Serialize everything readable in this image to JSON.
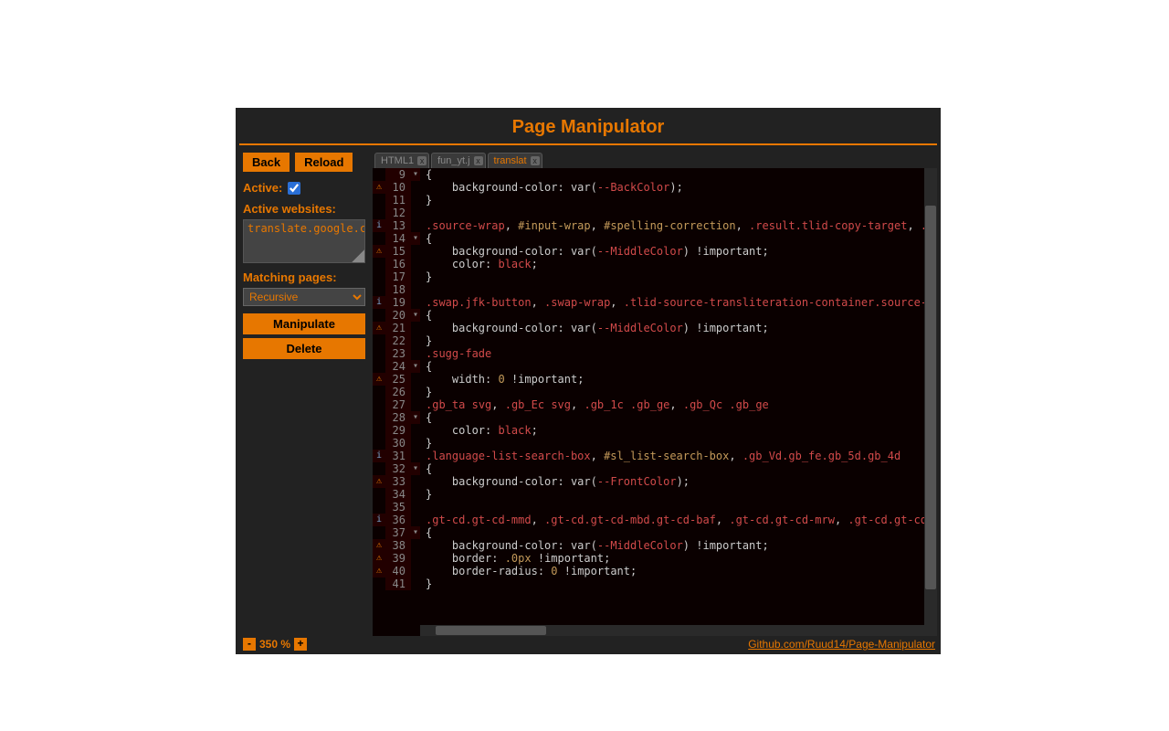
{
  "title": "Page Manipulator",
  "sidebar": {
    "back_label": "Back",
    "reload_label": "Reload",
    "active_label": "Active:",
    "active_checked": true,
    "active_websites_label": "Active websites:",
    "active_websites_value": "translate.google.c",
    "matching_pages_label": "Matching pages:",
    "matching_select_value": "Recursive",
    "manipulate_label": "Manipulate",
    "delete_label": "Delete"
  },
  "tabs": [
    {
      "label": "HTML1",
      "active": false
    },
    {
      "label": "fun_yt.j",
      "active": false
    },
    {
      "label": "translat",
      "active": true
    }
  ],
  "zoom": {
    "minus": "-",
    "plus": "+",
    "value": "350 %"
  },
  "github_link": "Github.com/Ruud14/Page-Manipulator",
  "code_lines": [
    {
      "n": 9,
      "icon": "",
      "fold": "▾",
      "tokens": [
        [
          "punc",
          "{"
        ]
      ]
    },
    {
      "n": 10,
      "icon": "⚠",
      "fold": "",
      "tokens": [
        [
          "prop",
          "    background-color"
        ],
        [
          "punc",
          ": "
        ],
        [
          "var",
          "var"
        ],
        [
          "punc",
          "("
        ],
        [
          "val",
          "--BackColor"
        ],
        [
          "punc",
          ");"
        ]
      ]
    },
    {
      "n": 11,
      "icon": "",
      "fold": "",
      "tokens": [
        [
          "punc",
          "}"
        ]
      ]
    },
    {
      "n": 12,
      "icon": "",
      "fold": "",
      "tokens": []
    },
    {
      "n": 13,
      "icon": "i",
      "fold": "",
      "tokens": [
        [
          "sel",
          ".source-wrap"
        ],
        [
          "punc",
          ", "
        ],
        [
          "id",
          "#input-wrap"
        ],
        [
          "punc",
          ", "
        ],
        [
          "id",
          "#spelling-correction"
        ],
        [
          "punc",
          ", "
        ],
        [
          "sel",
          ".result.tlid-copy-target"
        ],
        [
          "punc",
          ", "
        ],
        [
          "sel",
          ".tli"
        ]
      ]
    },
    {
      "n": 14,
      "icon": "",
      "fold": "▾",
      "tokens": [
        [
          "punc",
          "{"
        ]
      ]
    },
    {
      "n": 15,
      "icon": "⚠",
      "fold": "",
      "tokens": [
        [
          "prop",
          "    background-color"
        ],
        [
          "punc",
          ": "
        ],
        [
          "var",
          "var"
        ],
        [
          "punc",
          "("
        ],
        [
          "val",
          "--MiddleColor"
        ],
        [
          "punc",
          ") "
        ],
        [
          "imp",
          "!important"
        ],
        [
          "punc",
          ";"
        ]
      ]
    },
    {
      "n": 16,
      "icon": "",
      "fold": "",
      "tokens": [
        [
          "prop",
          "    color"
        ],
        [
          "punc",
          ": "
        ],
        [
          "val",
          "black"
        ],
        [
          "punc",
          ";"
        ]
      ]
    },
    {
      "n": 17,
      "icon": "",
      "fold": "",
      "tokens": [
        [
          "punc",
          "}"
        ]
      ]
    },
    {
      "n": 18,
      "icon": "",
      "fold": "",
      "tokens": []
    },
    {
      "n": 19,
      "icon": "i",
      "fold": "",
      "tokens": [
        [
          "sel",
          ".swap.jfk-button"
        ],
        [
          "punc",
          ", "
        ],
        [
          "sel",
          ".swap-wrap"
        ],
        [
          "punc",
          ", "
        ],
        [
          "sel",
          ".tlid-source-transliteration-container.source-tra"
        ]
      ]
    },
    {
      "n": 20,
      "icon": "",
      "fold": "▾",
      "tokens": [
        [
          "punc",
          "{"
        ]
      ]
    },
    {
      "n": 21,
      "icon": "⚠",
      "fold": "",
      "tokens": [
        [
          "prop",
          "    background-color"
        ],
        [
          "punc",
          ": "
        ],
        [
          "var",
          "var"
        ],
        [
          "punc",
          "("
        ],
        [
          "val",
          "--MiddleColor"
        ],
        [
          "punc",
          ") "
        ],
        [
          "imp",
          "!important"
        ],
        [
          "punc",
          ";"
        ]
      ]
    },
    {
      "n": 22,
      "icon": "",
      "fold": "",
      "tokens": [
        [
          "punc",
          "}"
        ]
      ]
    },
    {
      "n": 23,
      "icon": "",
      "fold": "",
      "tokens": [
        [
          "sel",
          ".sugg-fade"
        ]
      ]
    },
    {
      "n": 24,
      "icon": "",
      "fold": "▾",
      "tokens": [
        [
          "punc",
          "{"
        ]
      ]
    },
    {
      "n": 25,
      "icon": "⚠",
      "fold": "",
      "tokens": [
        [
          "prop",
          "    width"
        ],
        [
          "punc",
          ": "
        ],
        [
          "num",
          "0"
        ],
        [
          "punc",
          " "
        ],
        [
          "imp",
          "!important"
        ],
        [
          "punc",
          ";"
        ]
      ]
    },
    {
      "n": 26,
      "icon": "",
      "fold": "",
      "tokens": [
        [
          "punc",
          "}"
        ]
      ]
    },
    {
      "n": 27,
      "icon": "",
      "fold": "",
      "tokens": [
        [
          "sel",
          ".gb_ta"
        ],
        [
          "punc",
          " "
        ],
        [
          "val",
          "svg"
        ],
        [
          "punc",
          ", "
        ],
        [
          "sel",
          ".gb_Ec"
        ],
        [
          "punc",
          " "
        ],
        [
          "val",
          "svg"
        ],
        [
          "punc",
          ", "
        ],
        [
          "sel",
          ".gb_1c .gb_ge"
        ],
        [
          "punc",
          ", "
        ],
        [
          "sel",
          ".gb_Qc .gb_ge"
        ]
      ]
    },
    {
      "n": 28,
      "icon": "",
      "fold": "▾",
      "tokens": [
        [
          "punc",
          "{"
        ]
      ]
    },
    {
      "n": 29,
      "icon": "",
      "fold": "",
      "tokens": [
        [
          "prop",
          "    color"
        ],
        [
          "punc",
          ": "
        ],
        [
          "val",
          "black"
        ],
        [
          "punc",
          ";"
        ]
      ]
    },
    {
      "n": 30,
      "icon": "",
      "fold": "",
      "tokens": [
        [
          "punc",
          "}"
        ]
      ]
    },
    {
      "n": 31,
      "icon": "i",
      "fold": "",
      "tokens": [
        [
          "sel",
          ".language-list-search-box"
        ],
        [
          "punc",
          ", "
        ],
        [
          "id",
          "#sl_list-search-box"
        ],
        [
          "punc",
          ", "
        ],
        [
          "sel",
          ".gb_Vd.gb_fe.gb_5d.gb_4d"
        ]
      ]
    },
    {
      "n": 32,
      "icon": "",
      "fold": "▾",
      "tokens": [
        [
          "punc",
          "{"
        ]
      ]
    },
    {
      "n": 33,
      "icon": "⚠",
      "fold": "",
      "tokens": [
        [
          "prop",
          "    background-color"
        ],
        [
          "punc",
          ": "
        ],
        [
          "var",
          "var"
        ],
        [
          "punc",
          "("
        ],
        [
          "val",
          "--FrontColor"
        ],
        [
          "punc",
          ");"
        ]
      ]
    },
    {
      "n": 34,
      "icon": "",
      "fold": "",
      "tokens": [
        [
          "punc",
          "}"
        ]
      ]
    },
    {
      "n": 35,
      "icon": "",
      "fold": "",
      "tokens": []
    },
    {
      "n": 36,
      "icon": "i",
      "fold": "",
      "tokens": [
        [
          "sel",
          ".gt-cd.gt-cd-mmd"
        ],
        [
          "punc",
          ", "
        ],
        [
          "sel",
          ".gt-cd.gt-cd-mbd.gt-cd-baf"
        ],
        [
          "punc",
          ", "
        ],
        [
          "sel",
          ".gt-cd.gt-cd-mrw"
        ],
        [
          "punc",
          ", "
        ],
        [
          "sel",
          ".gt-cd.gt-cd-ms"
        ]
      ]
    },
    {
      "n": 37,
      "icon": "",
      "fold": "▾",
      "tokens": [
        [
          "punc",
          "{"
        ]
      ]
    },
    {
      "n": 38,
      "icon": "⚠",
      "fold": "",
      "tokens": [
        [
          "prop",
          "    background-color"
        ],
        [
          "punc",
          ": "
        ],
        [
          "var",
          "var"
        ],
        [
          "punc",
          "("
        ],
        [
          "val",
          "--MiddleColor"
        ],
        [
          "punc",
          ") "
        ],
        [
          "imp",
          "!important"
        ],
        [
          "punc",
          ";"
        ]
      ]
    },
    {
      "n": 39,
      "icon": "⚠",
      "fold": "",
      "tokens": [
        [
          "prop",
          "    border"
        ],
        [
          "punc",
          ": "
        ],
        [
          "num",
          ".0px"
        ],
        [
          "punc",
          " "
        ],
        [
          "imp",
          "!important"
        ],
        [
          "punc",
          ";"
        ]
      ]
    },
    {
      "n": 40,
      "icon": "⚠",
      "fold": "",
      "tokens": [
        [
          "prop",
          "    border-radius"
        ],
        [
          "punc",
          ": "
        ],
        [
          "num",
          "0"
        ],
        [
          "punc",
          " "
        ],
        [
          "imp",
          "!important"
        ],
        [
          "punc",
          ";"
        ]
      ]
    },
    {
      "n": 41,
      "icon": "",
      "fold": "",
      "tokens": [
        [
          "punc",
          "}"
        ]
      ]
    }
  ]
}
